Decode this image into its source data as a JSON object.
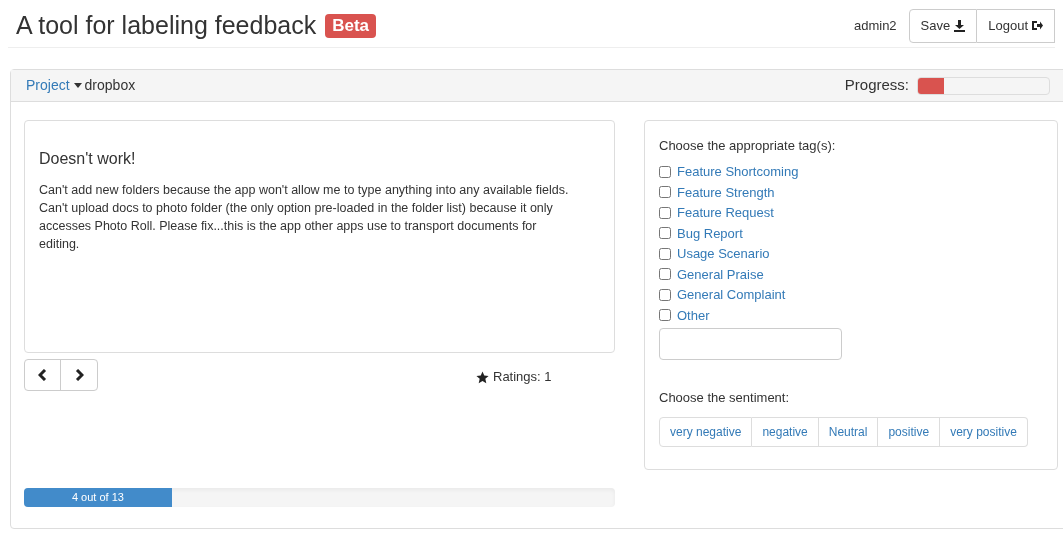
{
  "header": {
    "title": "A tool for labeling feedback",
    "badge": "Beta",
    "user": "admin2",
    "buttons": [
      {
        "label": "Save",
        "kind": "save"
      },
      {
        "label": "Logout",
        "kind": "logout"
      }
    ]
  },
  "project_bar": {
    "link": "Project",
    "project": "dropbox",
    "progress_label": "Progress:",
    "level": 0.2
  },
  "feedback": {
    "title": "Doesn't work!",
    "body": "Can't add new folders because the app won't allow me to type anything into any available fields. Can't upload docs to photo folder (the only option pre-loaded in the folder list) because it only accesses Photo Roll. Please fix...this is the app other apps use to transport documents for editing.",
    "ratings": "Ratings: 1",
    "progress": {
      "text": "4 out of 13",
      "level": 0.25
    }
  },
  "tags": {
    "heading": "Choose the appropriate tag(s):",
    "items": [
      {
        "label": "Feature Shortcoming",
        "checked": false
      },
      {
        "label": "Feature Strength",
        "checked": false
      },
      {
        "label": "Feature Request",
        "checked": false
      },
      {
        "label": "Bug Report",
        "checked": false
      },
      {
        "label": "Usage Scenario",
        "checked": false
      },
      {
        "label": "General Praise",
        "checked": false
      },
      {
        "label": "General Complaint",
        "checked": false
      },
      {
        "label": "Other",
        "checked": false
      }
    ]
  },
  "sentiment": {
    "heading": "Choose the sentiment:",
    "options": [
      {
        "label": "very negative",
        "selected": false
      },
      {
        "label": "negative",
        "selected": false
      },
      {
        "label": "Neutral",
        "selected": false
      },
      {
        "label": "positive",
        "selected": false
      },
      {
        "label": "very positive",
        "selected": false
      }
    ]
  }
}
